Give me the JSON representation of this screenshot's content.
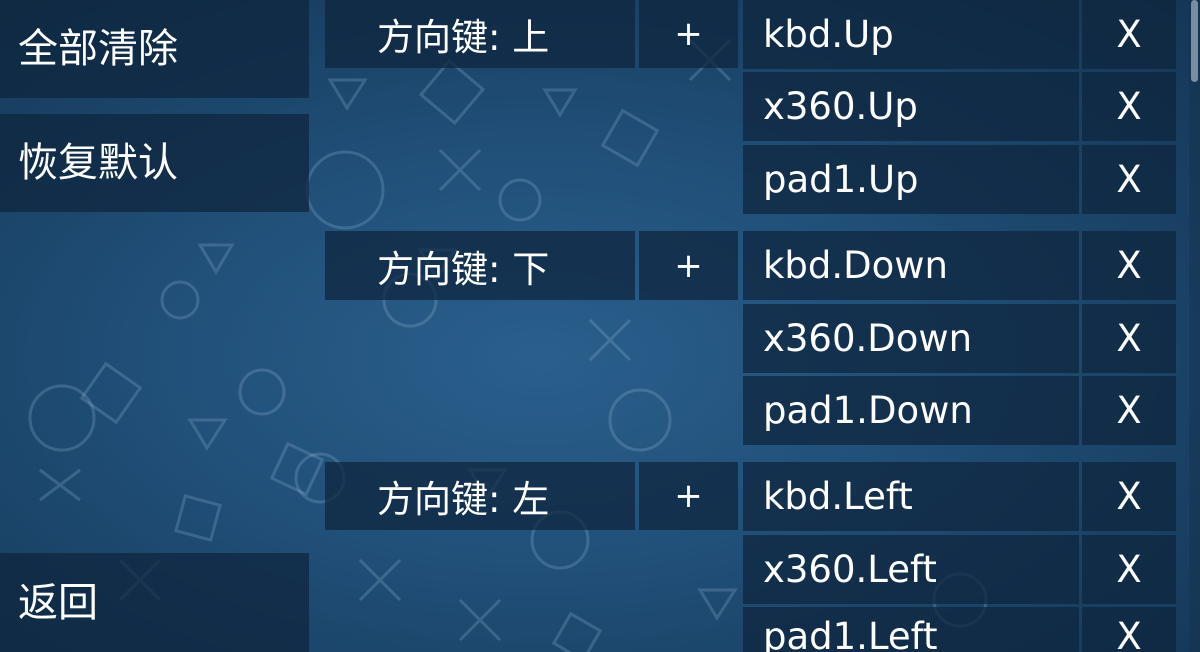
{
  "colors": {
    "background": "#22527c",
    "panel": "#0e243c",
    "text": "#ffffff"
  },
  "sidebar": {
    "clear_all": "全部清除",
    "restore_default": "恢复默认",
    "back": "返回"
  },
  "mappings": [
    {
      "key": "方向键: 上",
      "add": "+",
      "bindings": [
        {
          "name": "kbd.Up",
          "delete": "X"
        },
        {
          "name": "x360.Up",
          "delete": "X"
        },
        {
          "name": "pad1.Up",
          "delete": "X"
        }
      ]
    },
    {
      "key": "方向键: 下",
      "add": "+",
      "bindings": [
        {
          "name": "kbd.Down",
          "delete": "X"
        },
        {
          "name": "x360.Down",
          "delete": "X"
        },
        {
          "name": "pad1.Down",
          "delete": "X"
        }
      ]
    },
    {
      "key": "方向键: 左",
      "add": "+",
      "bindings": [
        {
          "name": "kbd.Left",
          "delete": "X"
        },
        {
          "name": "x360.Left",
          "delete": "X"
        },
        {
          "name": "pad1.Left",
          "delete": "X"
        }
      ]
    }
  ]
}
